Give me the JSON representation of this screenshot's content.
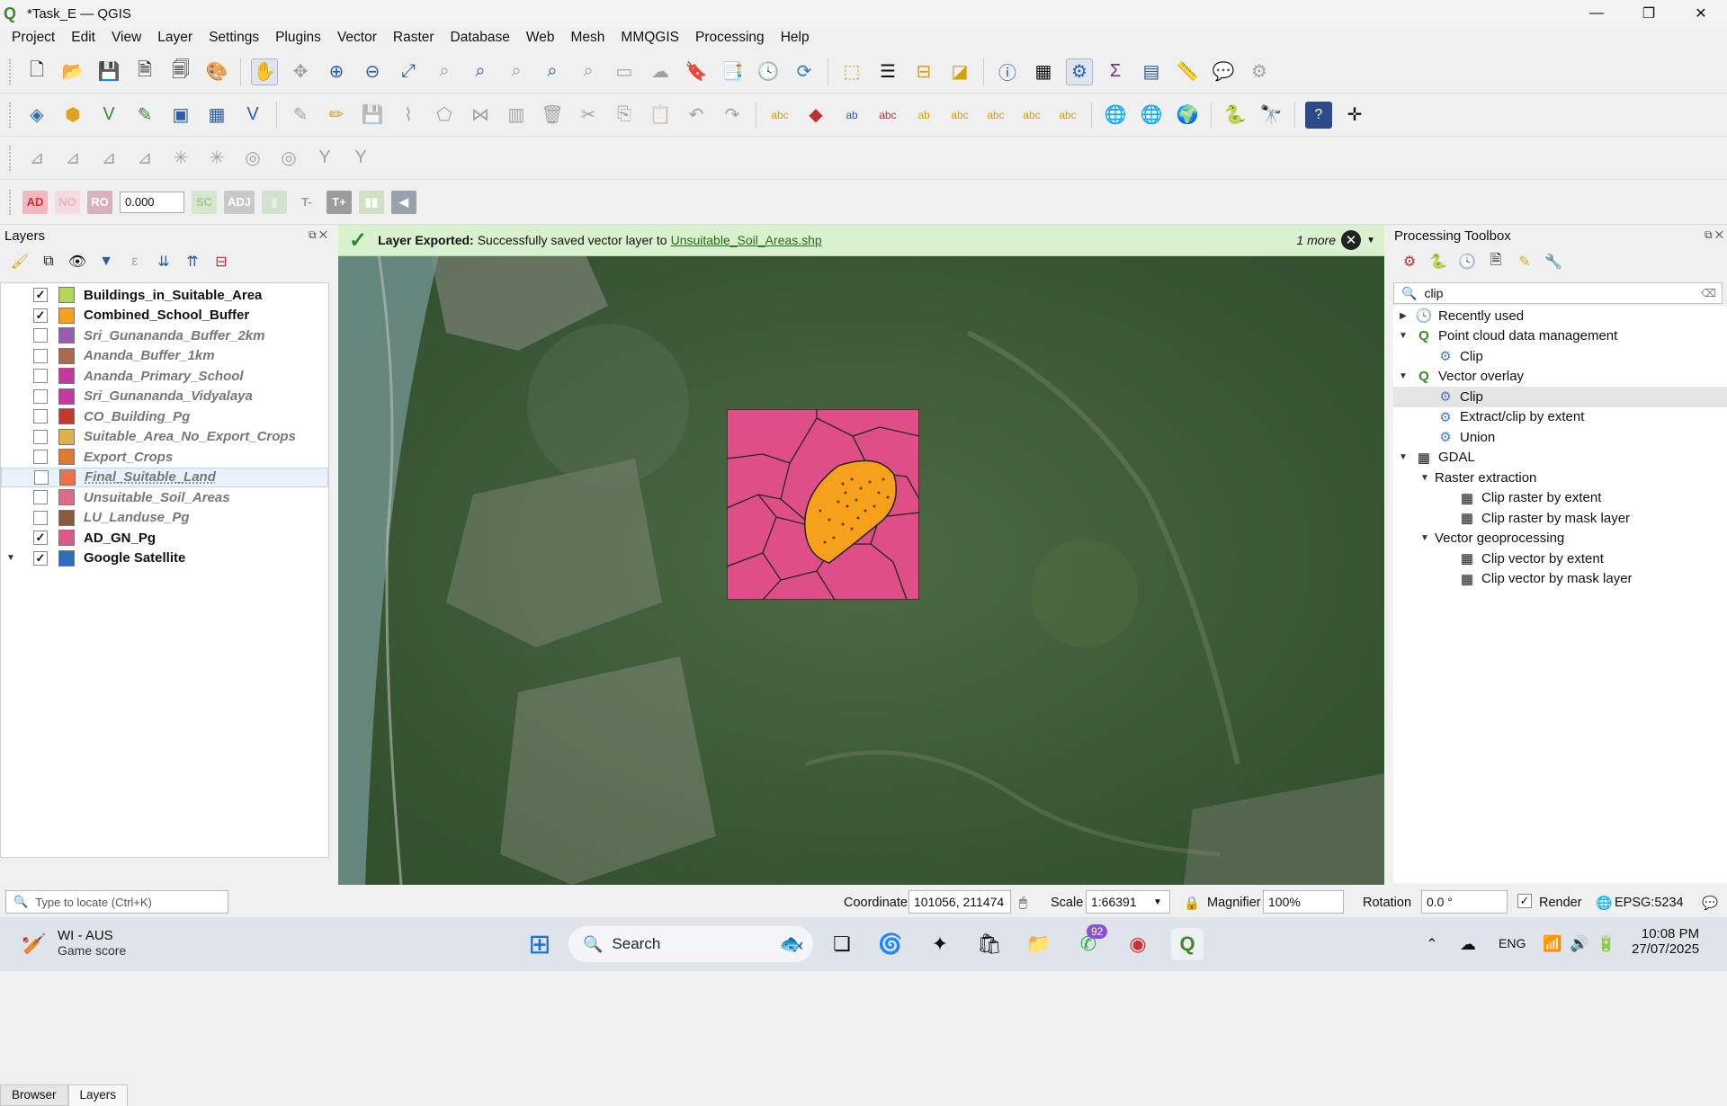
{
  "window": {
    "title": "*Task_E — QGIS",
    "minimize": "—",
    "restore": "❐",
    "close": "✕"
  },
  "menu": [
    "Project",
    "Edit",
    "View",
    "Layer",
    "Settings",
    "Plugins",
    "Vector",
    "Raster",
    "Database",
    "Web",
    "Mesh",
    "MMQGIS",
    "Processing",
    "Help"
  ],
  "digitize_toolbar": {
    "ad": "AD",
    "no": "NO",
    "ro": "RO",
    "value": "0.000",
    "sc": "SC",
    "adj": "ADJ",
    "t_minus": "T-",
    "t_plus": "T+"
  },
  "message": {
    "title": "Layer Exported:",
    "text": "Successfully saved vector layer to",
    "link": "Unsuitable_Soil_Areas.shp",
    "more": "1 more"
  },
  "layers_panel": {
    "title": "Layers",
    "items": [
      {
        "name": "Buildings_in_Suitable_Area",
        "checked": true,
        "color": "#b6d35a"
      },
      {
        "name": "Combined_School_Buffer",
        "checked": true,
        "color": "#f7a01c"
      },
      {
        "name": "Sri_Gunananda_Buffer_2km",
        "checked": false,
        "color": "#9b5bb0"
      },
      {
        "name": "Ananda_Buffer_1km",
        "checked": false,
        "color": "#a86b4f"
      },
      {
        "name": "Ananda_Primary_School",
        "checked": false,
        "color": "#c23aa0"
      },
      {
        "name": "Sri_Gunananda_Vidyalaya",
        "checked": false,
        "color": "#c23aa0"
      },
      {
        "name": "CO_Building_Pg",
        "checked": false,
        "color": "#c0392b"
      },
      {
        "name": "Suitable_Area_No_Export_Crops",
        "checked": false,
        "color": "#e0b04a"
      },
      {
        "name": "Export_Crops",
        "checked": false,
        "color": "#e07a30"
      },
      {
        "name": "Final_Suitable_Land",
        "checked": false,
        "color": "#e8734a"
      },
      {
        "name": "Unsuitable_Soil_Areas",
        "checked": false,
        "color": "#e06a8a"
      },
      {
        "name": "LU_Landuse_Pg",
        "checked": false,
        "color": "#8b5a3c"
      },
      {
        "name": "AD_GN_Pg",
        "checked": true,
        "color": "#e0558a"
      },
      {
        "name": "Google Satellite",
        "checked": true,
        "color": "#2a6fbf"
      }
    ]
  },
  "bottom_tabs": {
    "browser": "Browser",
    "layers": "Layers"
  },
  "locate_placeholder": "Type to locate (Ctrl+K)",
  "toolbox": {
    "title": "Processing Toolbox",
    "search": "clip",
    "tree": [
      {
        "label": "Recently used",
        "level": 0,
        "arrow": "▶",
        "icon": "🕓"
      },
      {
        "label": "Point cloud data management",
        "level": 0,
        "arrow": "▼",
        "icon": "Q"
      },
      {
        "label": "Clip",
        "level": 1,
        "arrow": "",
        "icon": "⚙"
      },
      {
        "label": "Vector overlay",
        "level": 0,
        "arrow": "▼",
        "icon": "Q"
      },
      {
        "label": "Clip",
        "level": 1,
        "arrow": "",
        "icon": "⚙",
        "selected": true
      },
      {
        "label": "Extract/clip by extent",
        "level": 1,
        "arrow": "",
        "icon": "⚙"
      },
      {
        "label": "Union",
        "level": 1,
        "arrow": "",
        "icon": "⚙"
      },
      {
        "label": "GDAL",
        "level": 0,
        "arrow": "▼",
        "icon": "▦"
      },
      {
        "label": "Raster extraction",
        "level": 1,
        "arrow": "▼",
        "icon": ""
      },
      {
        "label": "Clip raster by extent",
        "level": 2,
        "arrow": "",
        "icon": "▦"
      },
      {
        "label": "Clip raster by mask layer",
        "level": 2,
        "arrow": "",
        "icon": "▦"
      },
      {
        "label": "Vector geoprocessing",
        "level": 1,
        "arrow": "▼",
        "icon": ""
      },
      {
        "label": "Clip vector by extent",
        "level": 2,
        "arrow": "",
        "icon": "▦"
      },
      {
        "label": "Clip vector by mask layer",
        "level": 2,
        "arrow": "",
        "icon": "▦"
      }
    ]
  },
  "status": {
    "coordinate_label": "Coordinate",
    "coordinate": "101056, 211474",
    "scale_label": "Scale",
    "scale": "1:66391",
    "magnifier_label": "Magnifier",
    "magnifier": "100%",
    "rotation_label": "Rotation",
    "rotation": "0.0 °",
    "render": "Render",
    "crs": "EPSG:5234"
  },
  "taskbar": {
    "widget_title": "WI - AUS",
    "widget_sub": "Game score",
    "search": "Search",
    "badge": "92",
    "time": "10:08 PM",
    "date": "27/07/2025",
    "lang": "ENG"
  }
}
